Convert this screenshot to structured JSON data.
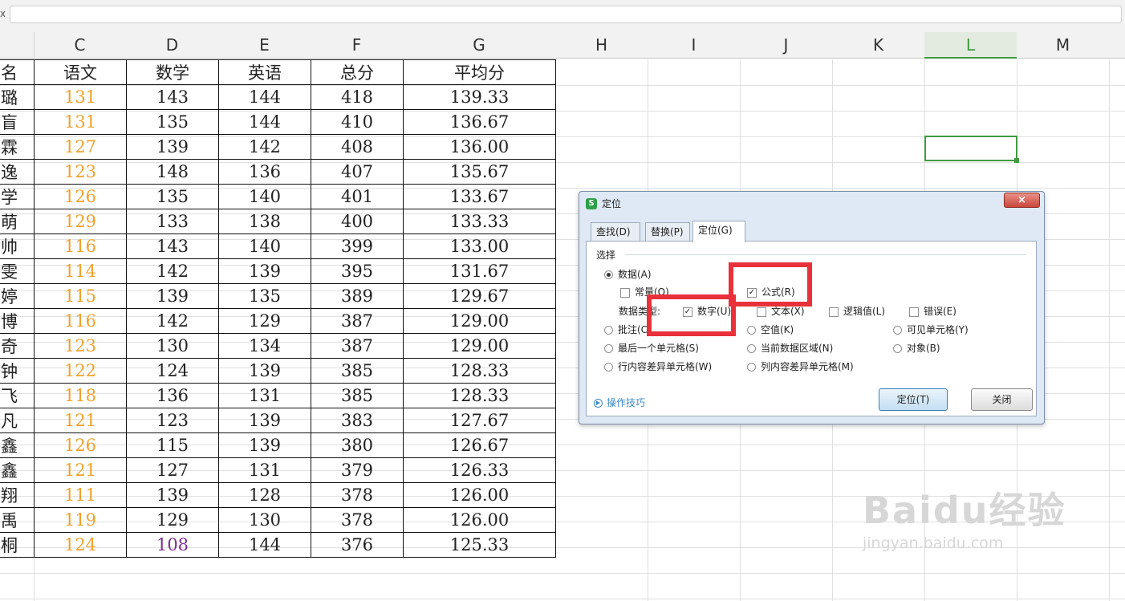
{
  "formula_bar": {
    "fx": "x",
    "value": ""
  },
  "columns": [
    "C",
    "D",
    "E",
    "F",
    "G",
    "H",
    "I",
    "J",
    "K",
    "L",
    "M"
  ],
  "selected_column": "L",
  "table": {
    "headers": [
      "名",
      "语文",
      "数学",
      "英语",
      "总分",
      "平均分"
    ],
    "rows": [
      [
        "璐",
        "131",
        "143",
        "144",
        "418",
        "139.33"
      ],
      [
        "盲",
        "131",
        "135",
        "144",
        "410",
        "136.67"
      ],
      [
        "霖",
        "127",
        "139",
        "142",
        "408",
        "136.00"
      ],
      [
        "逸",
        "123",
        "148",
        "136",
        "407",
        "135.67"
      ],
      [
        "学",
        "126",
        "135",
        "140",
        "401",
        "133.67"
      ],
      [
        "萌",
        "129",
        "133",
        "138",
        "400",
        "133.33"
      ],
      [
        "帅",
        "116",
        "143",
        "140",
        "399",
        "133.00"
      ],
      [
        "雯",
        "114",
        "142",
        "139",
        "395",
        "131.67"
      ],
      [
        "婷",
        "115",
        "139",
        "135",
        "389",
        "129.67"
      ],
      [
        "博",
        "116",
        "142",
        "129",
        "387",
        "129.00"
      ],
      [
        "奇",
        "123",
        "130",
        "134",
        "387",
        "129.00"
      ],
      [
        "钟",
        "122",
        "124",
        "139",
        "385",
        "128.33"
      ],
      [
        "飞",
        "118",
        "136",
        "131",
        "385",
        "128.33"
      ],
      [
        "凡",
        "121",
        "123",
        "139",
        "383",
        "127.67"
      ],
      [
        "鑫",
        "126",
        "115",
        "139",
        "380",
        "126.67"
      ],
      [
        "鑫",
        "121",
        "127",
        "131",
        "379",
        "126.33"
      ],
      [
        "翔",
        "111",
        "139",
        "128",
        "378",
        "126.00"
      ],
      [
        "禹",
        "119",
        "129",
        "130",
        "378",
        "126.00"
      ],
      [
        "桐",
        "124",
        "108",
        "144",
        "376",
        "125.33"
      ]
    ],
    "colors": {
      "chinese_score": "#f0a12c",
      "highlight_math": "#7d2c91"
    }
  },
  "dialog": {
    "title": "定位",
    "app_icon": "S",
    "close": "×",
    "tabs": [
      "查找(D)",
      "替换(P)",
      "定位(G)"
    ],
    "active_tab": "定位(G)",
    "group_label": "选择",
    "options": {
      "data": "数据(A)",
      "constant": "常量(O)",
      "formula": "公式(R)",
      "data_type_label": "数据类型:",
      "number": "数字(U)",
      "text": "文本(X)",
      "logical": "逻辑值(L)",
      "error": "错误(E)",
      "comment": "批注(C)",
      "blank": "空值(K)",
      "visible_cells": "可见单元格(Y)",
      "last_cell": "最后一个单元格(S)",
      "current_region": "当前数据区域(N)",
      "objects": "对象(B)",
      "row_diff": "行内容差异单元格(W)",
      "col_diff": "列内容差异单元格(M)"
    },
    "tips": "操作技巧",
    "ok": "定位(T)",
    "cancel": "关闭",
    "accent": "#e8313a"
  },
  "watermark": {
    "brand": "Baidu经验",
    "url": "jingyan.baidu.com"
  }
}
